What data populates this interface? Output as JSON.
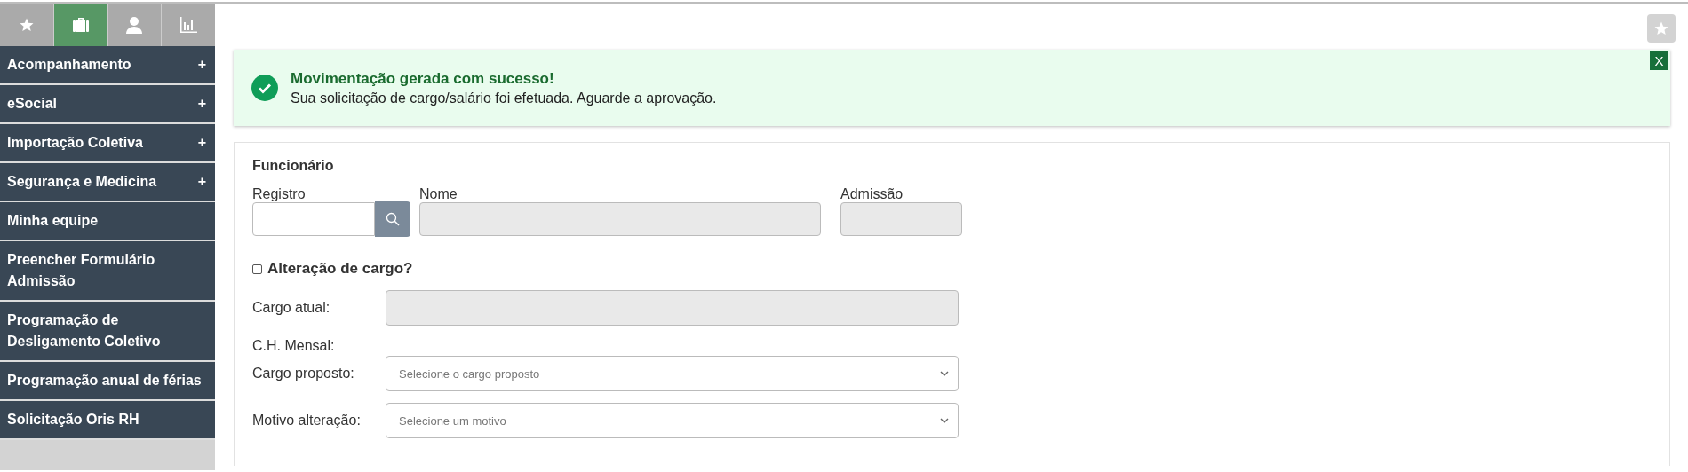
{
  "sidebar": {
    "tabs": [
      {
        "kind": "star",
        "selected": false
      },
      {
        "kind": "briefcase",
        "selected": true
      },
      {
        "kind": "person",
        "selected": false
      },
      {
        "kind": "chart",
        "selected": false
      }
    ],
    "items": [
      {
        "label": "Acompanhamento",
        "toggle": "+"
      },
      {
        "label": "eSocial",
        "toggle": "+"
      },
      {
        "label": "Importação Coletiva",
        "toggle": "+"
      },
      {
        "label": "Segurança e Medicina",
        "toggle": "+"
      },
      {
        "label": "Minha equipe"
      },
      {
        "label": "Preencher Formulário Admissão"
      },
      {
        "label": "Programação de Desligamento Coletivo"
      },
      {
        "label": "Programação anual de férias"
      },
      {
        "label": "Solicitação Oris RH"
      }
    ]
  },
  "alert": {
    "title": "Movimentação gerada com sucesso!",
    "message": "Sua solicitação de cargo/salário foi efetuada. Aguarde a aprovação.",
    "close": "X"
  },
  "form": {
    "section": "Funcionário",
    "top_fields": [
      {
        "label": "Registro",
        "kind": "search",
        "disabled": false
      },
      {
        "label": "Nome",
        "kind": "text",
        "disabled": true
      },
      {
        "label": "Admissão",
        "kind": "text",
        "disabled": true
      }
    ],
    "checkbox": {
      "label": "Alteração de cargo?",
      "checked": false
    },
    "rows": [
      {
        "label": "Cargo atual:",
        "kind": "input",
        "disabled": true
      },
      {
        "label": "C.H. Mensal:",
        "kind": "label"
      },
      {
        "label": "Cargo proposto:",
        "kind": "select",
        "placeholder": "Selecione o cargo proposto"
      },
      {
        "label": "Motivo alteração:",
        "kind": "select",
        "placeholder": "Selecione um motivo"
      }
    ]
  }
}
